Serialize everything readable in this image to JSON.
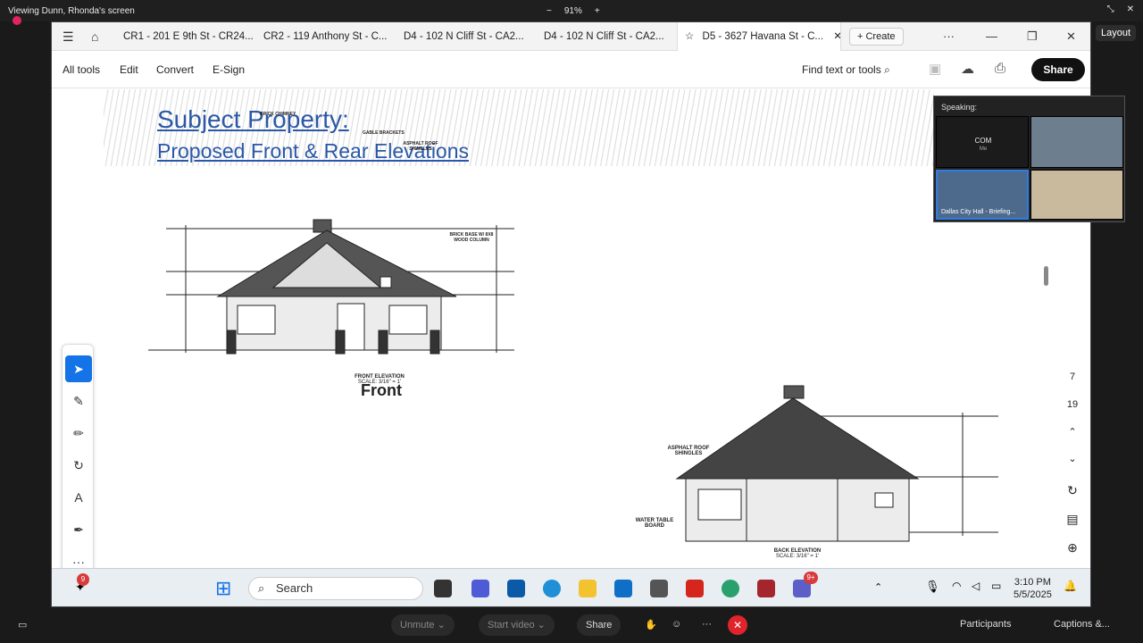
{
  "zoom_top": {
    "viewing": "Viewing Dunn, Rhonda's screen",
    "zoom_minus": "−",
    "zoom_level": "91%",
    "zoom_plus": "+",
    "layout": "Layout"
  },
  "browser": {
    "tabs": [
      {
        "label": "CR1 - 201 E 9th St - CR24..."
      },
      {
        "label": "CR2 - 119 Anthony St - C..."
      },
      {
        "label": "D4 - 102 N Cliff St - CA2..."
      },
      {
        "label": "D4 - 102 N Cliff St - CA2..."
      },
      {
        "label": "D5 - 3627 Havana St - C..."
      }
    ],
    "create": "Create",
    "more": "···"
  },
  "toolbar": {
    "all_tools": "All tools",
    "edit": "Edit",
    "convert": "Convert",
    "esign": "E-Sign",
    "find": "Find text or tools",
    "share": "Share"
  },
  "document": {
    "title": "Subject Property:",
    "subtitle": "Proposed Front & Rear Elevations",
    "front_label": "Front",
    "front_caption": "FRONT ELEVATION",
    "front_scale": "SCALE: 3/16\" = 1'",
    "back_caption": "BACK ELEVATION",
    "back_scale": "SCALE: 3/16\" = 1'",
    "notes_front": [
      "BRICK CHIMNEY",
      "GABLE BRACKETS",
      "ASPHALT ROOF SHINGLES",
      "BRICK BASE W/ 8X8 WOOD COLUMN"
    ],
    "notes_back": [
      "ASPHALT ROOF SHINGLES",
      "WATER TABLE BOARD"
    ]
  },
  "right_rail": {
    "page_current": "7",
    "page_total": "19"
  },
  "video": {
    "speaking": "Speaking:",
    "com_label": "COM",
    "com_sub": "Me",
    "tile_dallas": "Dallas City Hall - Briefing..."
  },
  "taskbar": {
    "search": "Search",
    "time": "3:10 PM",
    "date": "5/5/2025",
    "badge_left": "9",
    "badge_teams": "9+"
  },
  "zoom_bottom": {
    "unmute": "Unmute",
    "start_video": "Start video",
    "share": "Share",
    "participants": "Participants",
    "captions": "Captions &..."
  }
}
